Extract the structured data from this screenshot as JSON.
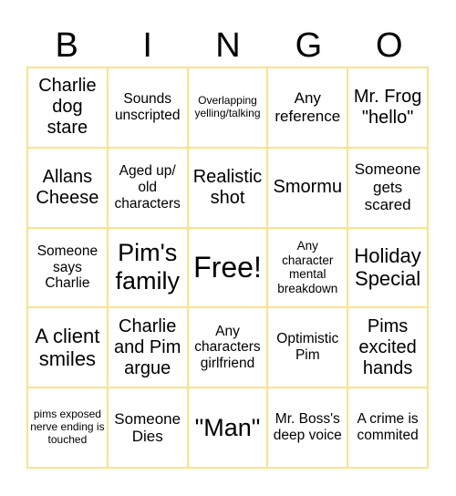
{
  "header": [
    "B",
    "I",
    "N",
    "G",
    "O"
  ],
  "line_color": "#ffe282",
  "cells": [
    {
      "text": "Charlie dog stare",
      "size": "s20"
    },
    {
      "text": "Sounds unscripted",
      "size": "s15"
    },
    {
      "text": "Overlapping yelling/talking",
      "size": "s12"
    },
    {
      "text": "Any reference",
      "size": "s17"
    },
    {
      "text": "Mr. Frog \"hello\"",
      "size": "s20"
    },
    {
      "text": "Allans Cheese",
      "size": "s20"
    },
    {
      "text": "Aged up/ old characters",
      "size": "s15"
    },
    {
      "text": "Realistic shot",
      "size": "s20"
    },
    {
      "text": "Smormu",
      "size": "s20"
    },
    {
      "text": "Someone gets scared",
      "size": "s17"
    },
    {
      "text": "Someone says Charlie",
      "size": "s15"
    },
    {
      "text": "Pim's family",
      "size": "s27"
    },
    {
      "text": "Free!",
      "size": "s32"
    },
    {
      "text": "Any character mental breakdown",
      "size": "s13"
    },
    {
      "text": "Holiday Special",
      "size": "s22"
    },
    {
      "text": "A client smiles",
      "size": "s22"
    },
    {
      "text": "Charlie and Pim argue",
      "size": "s20"
    },
    {
      "text": "Any characters girlfriend",
      "size": "s15"
    },
    {
      "text": "Optimistic Pim",
      "size": "s15"
    },
    {
      "text": "Pims excited hands",
      "size": "s20"
    },
    {
      "text": "pims exposed nerve ending is touched",
      "size": "s12"
    },
    {
      "text": "Someone Dies",
      "size": "s17"
    },
    {
      "text": "\"Man\"",
      "size": "s27"
    },
    {
      "text": "Mr. Boss's deep voice",
      "size": "s15"
    },
    {
      "text": "A crime is commited",
      "size": "s15"
    }
  ]
}
